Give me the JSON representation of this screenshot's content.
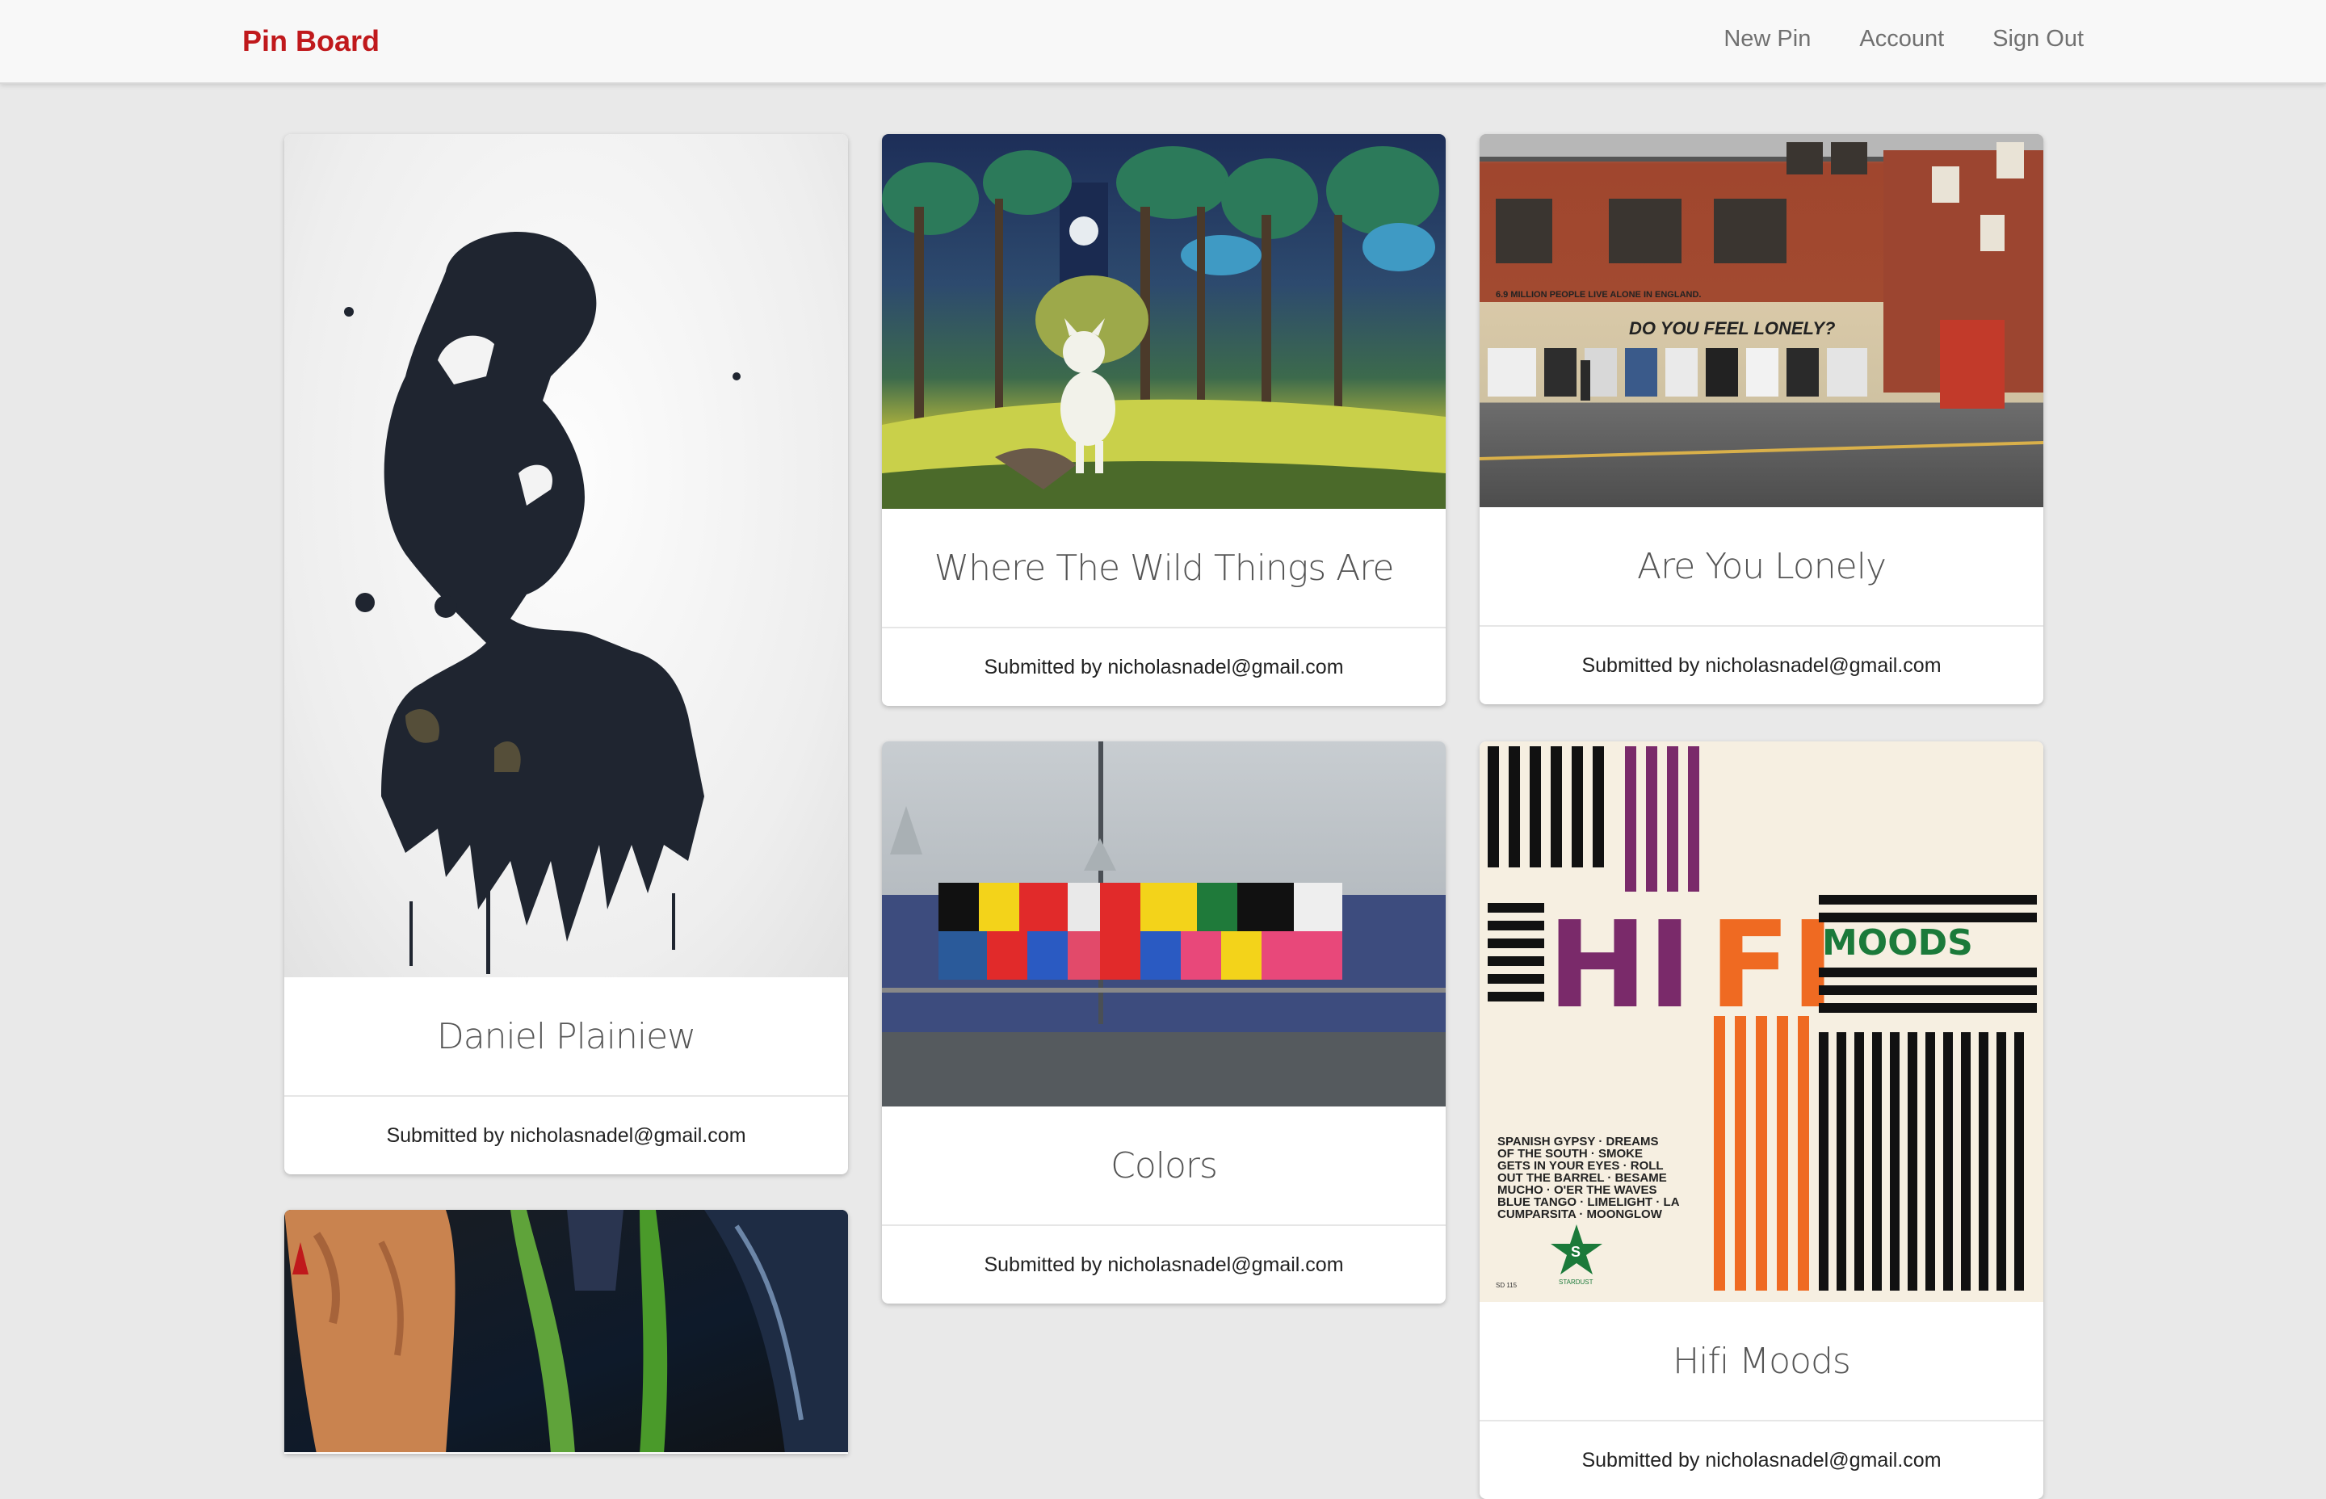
{
  "nav": {
    "brand": "Pin Board",
    "links": [
      {
        "label": "New Pin"
      },
      {
        "label": "Account"
      },
      {
        "label": "Sign Out"
      }
    ]
  },
  "pins": [
    {
      "title": "Daniel Plainiew",
      "submitted": "Submitted by nicholasnadel@gmail.com"
    },
    {
      "title": "Where The Wild Things Are",
      "submitted": "Submitted by nicholasnadel@gmail.com"
    },
    {
      "title": "Are You Lonely",
      "submitted": "Submitted by nicholasnadel@gmail.com"
    },
    {
      "title": "Colors",
      "submitted": "Submitted by nicholasnadel@gmail.com"
    },
    {
      "title": "Hifi Moods",
      "submitted": "Submitted by nicholasnadel@gmail.com"
    }
  ],
  "image_text": {
    "lonely_banner_small": "6.9 MILLION PEOPLE LIVE ALONE IN ENGLAND.",
    "lonely_banner": "DO YOU FEEL LONELY?",
    "hifi_left": "HI",
    "hifi_mid": "FI",
    "hifi_right": "MOODS",
    "hifi_tracklist": [
      "SPANISH GYPSY · DREAMS",
      "OF THE SOUTH · SMOKE",
      "GETS IN YOUR EYES · ROLL",
      "OUT THE BARREL · BESAME",
      "MUCHO · O'ER THE WAVES",
      "BLUE TANGO · LIMELIGHT · LA",
      "CUMPARSITA · MOONGLOW"
    ],
    "hifi_label": "STARDUST",
    "hifi_catalog": "SD 115",
    "hifi_star": "S"
  },
  "colors": {
    "brand": "#c0191c",
    "background": "#e9e9e9",
    "nav_link": "#707070"
  }
}
